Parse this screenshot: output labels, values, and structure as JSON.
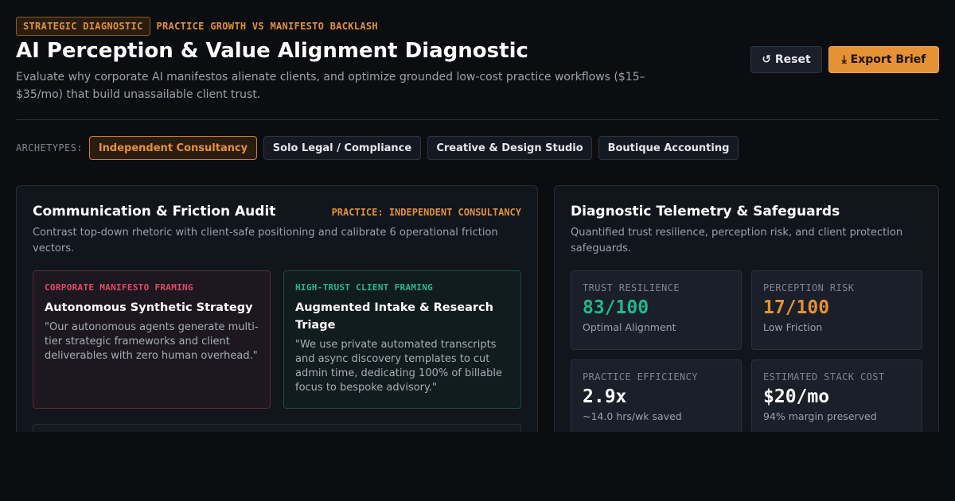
{
  "header": {
    "badge": "STRATEGIC DIAGNOSTIC",
    "subtag": "PRACTICE GROWTH VS MANIFESTO BACKLASH",
    "title": "AI Perception & Value Alignment Diagnostic",
    "subtitle": "Evaluate why corporate AI manifestos alienate clients, and optimize grounded low-cost practice workflows ($15–$35/mo) that build unassailable client trust.",
    "reset_label": "↺ Reset",
    "export_label": "⤓ Export Brief"
  },
  "archetypes": {
    "label": "ARCHETYPES:",
    "items": [
      {
        "label": "Independent Consultancy",
        "active": true
      },
      {
        "label": "Solo Legal / Compliance",
        "active": false
      },
      {
        "label": "Creative & Design Studio",
        "active": false
      },
      {
        "label": "Boutique Accounting",
        "active": false
      }
    ]
  },
  "audit": {
    "title": "Communication & Friction Audit",
    "practice_tag": "PRACTICE: INDEPENDENT CONSULTANCY",
    "description": "Contrast top-down rhetoric with client-safe positioning and calibrate 6 operational friction vectors.",
    "corporate": {
      "kicker": "CORPORATE MANIFESTO FRAMING",
      "heading": "Autonomous Synthetic Strategy",
      "quote": "\"Our autonomous agents generate multi-tier strategic frameworks and client deliverables with zero human overhead.\""
    },
    "trust": {
      "kicker": "HIGH-TRUST CLIENT FRAMING",
      "heading": "Augmented Intake & Research Triage",
      "quote": "\"We use private automated transcripts and async discovery templates to cut admin time, dedicating 100% of billable focus to bespoke advisory.\""
    }
  },
  "telemetry": {
    "title": "Diagnostic Telemetry & Safeguards",
    "description": "Quantified trust resilience, perception risk, and client protection safeguards.",
    "metrics": [
      {
        "label": "TRUST RESILIENCE",
        "value": "83/100",
        "note": "Optimal Alignment",
        "color": "#22b88a"
      },
      {
        "label": "PERCEPTION RISK",
        "value": "17/100",
        "note": "Low Friction",
        "color": "#e59136"
      },
      {
        "label": "PRACTICE EFFICIENCY",
        "value": "2.9x",
        "note": "~14.0 hrs/wk saved",
        "color": "#ffffff"
      },
      {
        "label": "ESTIMATED STACK COST",
        "value": "$20/mo",
        "note": "94% margin preserved",
        "color": "#ffffff"
      }
    ]
  }
}
